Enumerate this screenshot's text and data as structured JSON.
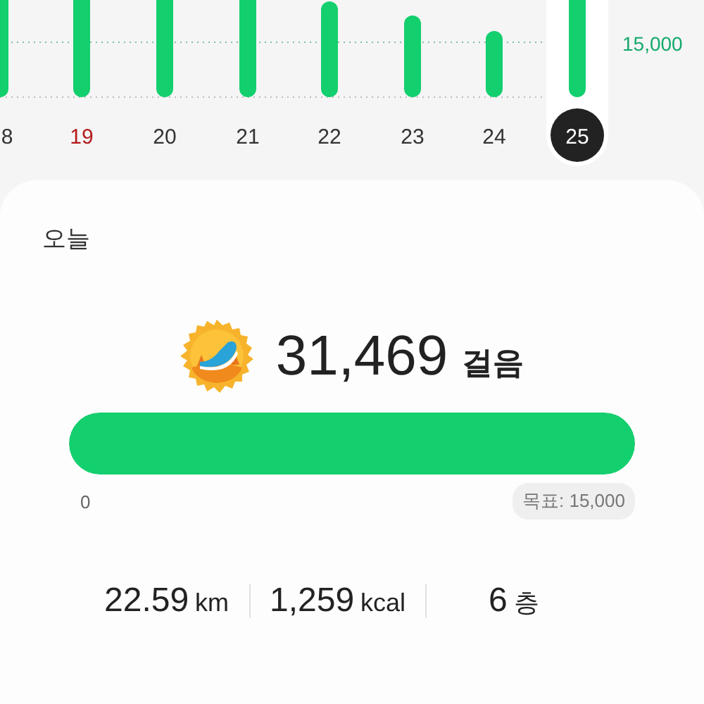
{
  "chart": {
    "goal_label": "15,000",
    "days": [
      {
        "label": "8",
        "holiday": false,
        "selected": false
      },
      {
        "label": "19",
        "holiday": true,
        "selected": false
      },
      {
        "label": "20",
        "holiday": false,
        "selected": false
      },
      {
        "label": "21",
        "holiday": false,
        "selected": false
      },
      {
        "label": "22",
        "holiday": false,
        "selected": false
      },
      {
        "label": "23",
        "holiday": false,
        "selected": false
      },
      {
        "label": "24",
        "holiday": false,
        "selected": false
      },
      {
        "label": "25",
        "holiday": false,
        "selected": true
      }
    ]
  },
  "today": {
    "title": "오늘",
    "steps": "31,469",
    "steps_unit": "걸음",
    "progress": {
      "level": 1,
      "min_label": "0",
      "goal": "목표: 15,000"
    },
    "stats": [
      {
        "value": "22.59",
        "unit": "km"
      },
      {
        "value": "1,259",
        "unit": "kcal"
      },
      {
        "value": "6",
        "unit": "층"
      }
    ]
  }
}
